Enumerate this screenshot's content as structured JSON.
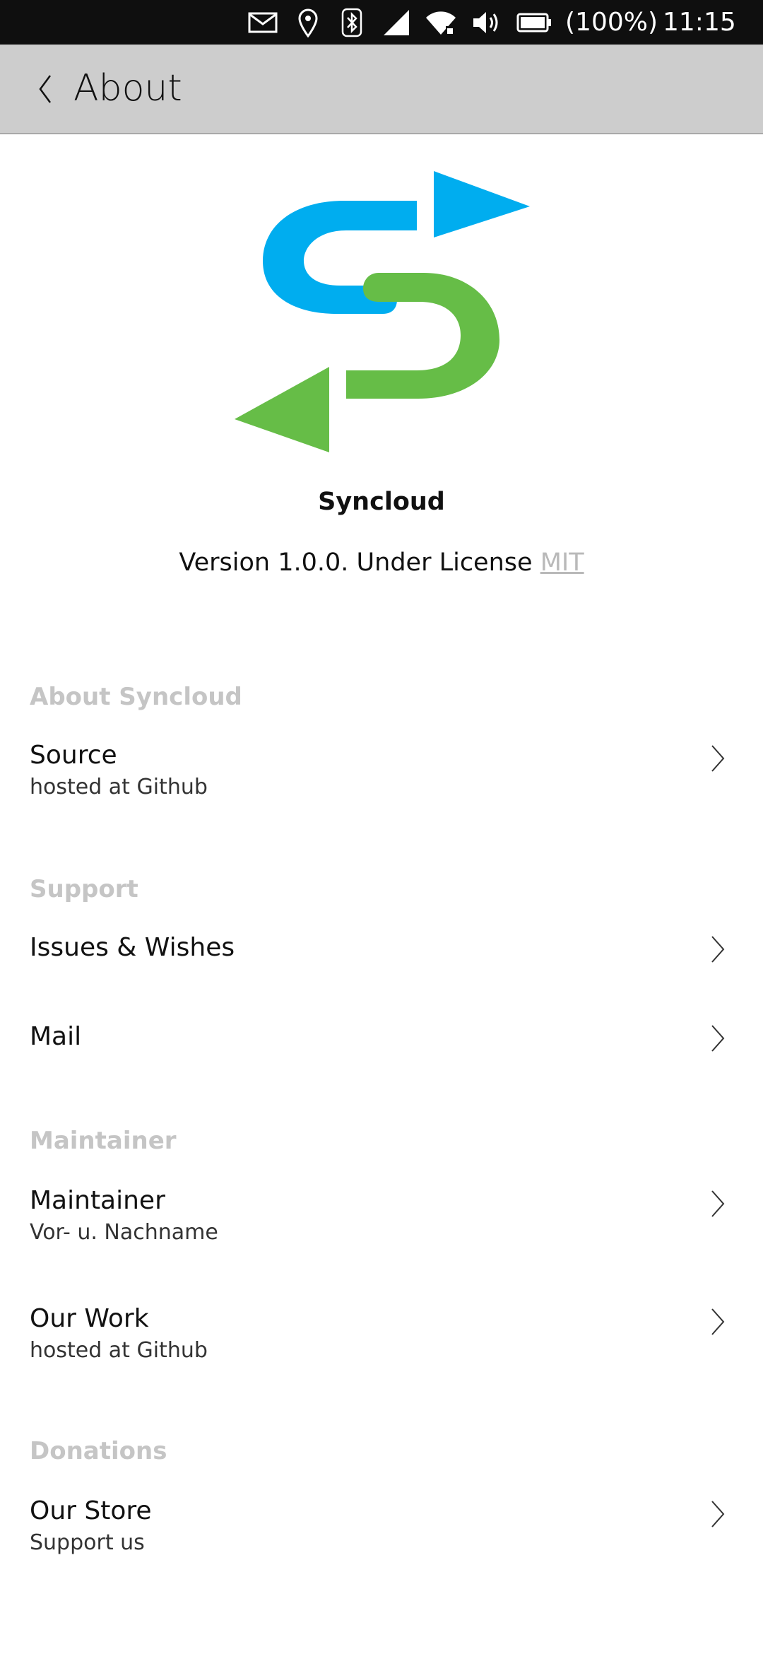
{
  "status_bar": {
    "icons": [
      "mail-icon",
      "location-icon",
      "bluetooth-icon",
      "signal-icon",
      "wifi-icon",
      "volume-icon",
      "battery-icon"
    ],
    "battery_text": "(100%)",
    "time": "11:15"
  },
  "header": {
    "title": "About"
  },
  "app": {
    "name": "Syncloud",
    "version_text": "Version 1.0.0. Under License",
    "license_link": "MIT",
    "logo_colors": {
      "blue": "#00adef",
      "green": "#66bd47"
    }
  },
  "sections": [
    {
      "title": "About Syncloud",
      "items": [
        {
          "title": "Source",
          "subtitle": "hosted at Github"
        }
      ]
    },
    {
      "title": "Support",
      "items": [
        {
          "title": "Issues & Wishes"
        },
        {
          "title": "Mail"
        }
      ]
    },
    {
      "title": "Maintainer",
      "items": [
        {
          "title": "Maintainer",
          "subtitle": "Vor- u. Nachname"
        },
        {
          "title": "Our Work",
          "subtitle": "hosted at Github"
        }
      ]
    },
    {
      "title": "Donations",
      "items": [
        {
          "title": "Our Store",
          "subtitle": "Support us"
        }
      ]
    }
  ]
}
